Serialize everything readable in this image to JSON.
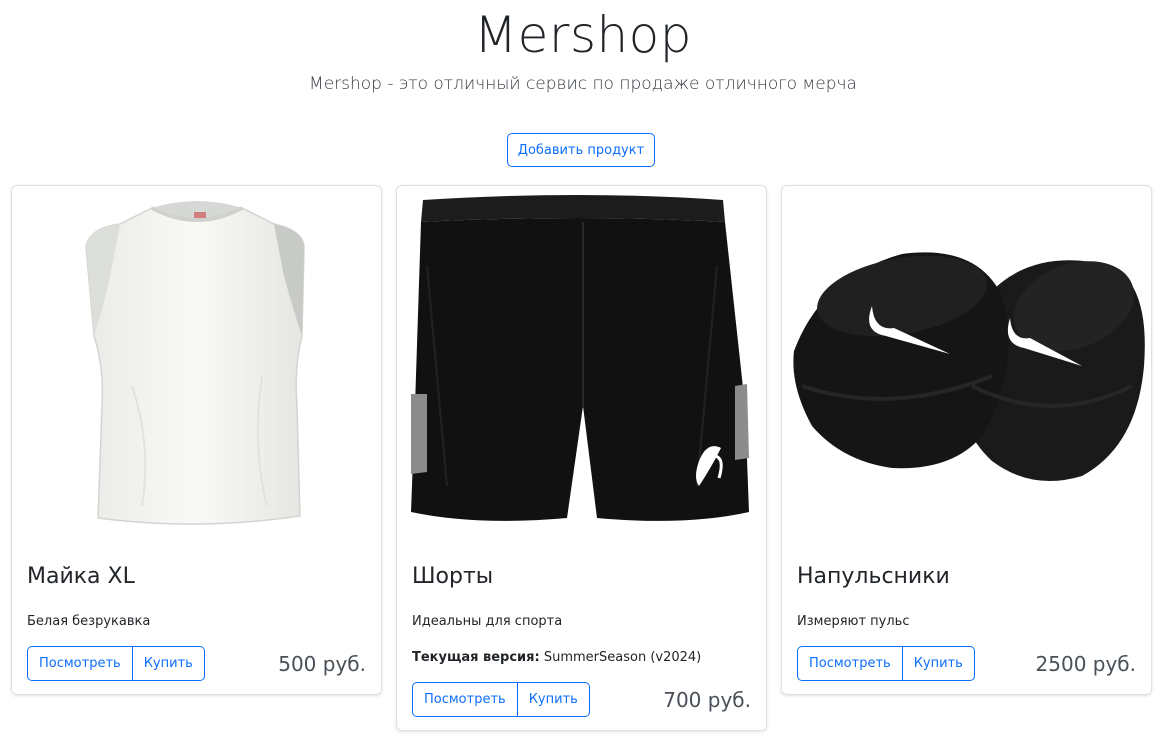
{
  "header": {
    "title": "Mershop",
    "lead": "Mershop - это отличный сервис по продаже отличного мерча",
    "add_button": "Добавить продукт"
  },
  "products": [
    {
      "title": "Майка XL",
      "description": "Белая безрукавка",
      "view_label": "Посмотреть",
      "buy_label": "Купить",
      "price": "500 руб.",
      "image": "white-sleeveless-shirt"
    },
    {
      "title": "Шорты",
      "description": "Идеальны для спорта",
      "version_label": "Текущая версия:",
      "version_value": " SummerSeason (v2024)",
      "view_label": "Посмотреть",
      "buy_label": "Купить",
      "price": "700 руб.",
      "image": "black-sport-shorts"
    },
    {
      "title": "Напульсники",
      "description": "Измеряют пульс",
      "view_label": "Посмотреть",
      "buy_label": "Купить",
      "price": "2500 руб.",
      "image": "black-wristbands"
    }
  ]
}
